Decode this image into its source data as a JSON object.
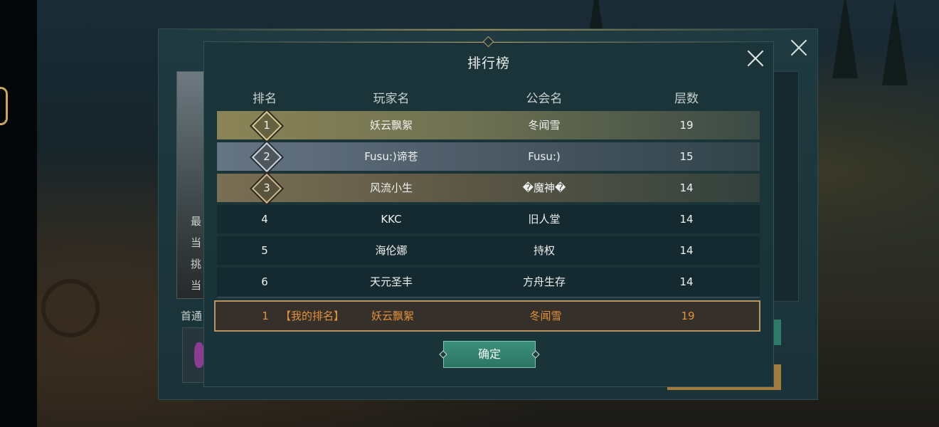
{
  "dialog": {
    "title": "排行榜",
    "headers": {
      "rank": "排名",
      "player": "玩家名",
      "guild": "公会名",
      "floor": "层数"
    },
    "rows": [
      {
        "rank": "1",
        "player": "妖云飘絮",
        "guild": "冬闻雪",
        "floor": "19",
        "medal": "gold"
      },
      {
        "rank": "2",
        "player": "Fusu:)谛苍",
        "guild": "Fusu:)",
        "floor": "15",
        "medal": "silver"
      },
      {
        "rank": "3",
        "player": "风流小生",
        "guild": "�魔神�",
        "floor": "14",
        "medal": "bronze"
      },
      {
        "rank": "4",
        "player": "KKC",
        "guild": "旧人堂",
        "floor": "14"
      },
      {
        "rank": "5",
        "player": "海伦娜",
        "guild": "持权",
        "floor": "14"
      },
      {
        "rank": "6",
        "player": "天元圣丰",
        "guild": "方舟生存",
        "floor": "14"
      }
    ],
    "my_rank": {
      "rank": "1",
      "label": "【我的排名】",
      "player": "妖云飘絮",
      "guild": "冬闻雪",
      "floor": "19"
    },
    "confirm_label": "确定"
  },
  "background_panel": {
    "side_labels": [
      "最",
      "当",
      "挑",
      "当"
    ],
    "first_clear_label": "首通"
  },
  "colors": {
    "accent_gold": "#b79560",
    "my_rank_text": "#e5923a",
    "confirm_green": "#2b7564"
  }
}
